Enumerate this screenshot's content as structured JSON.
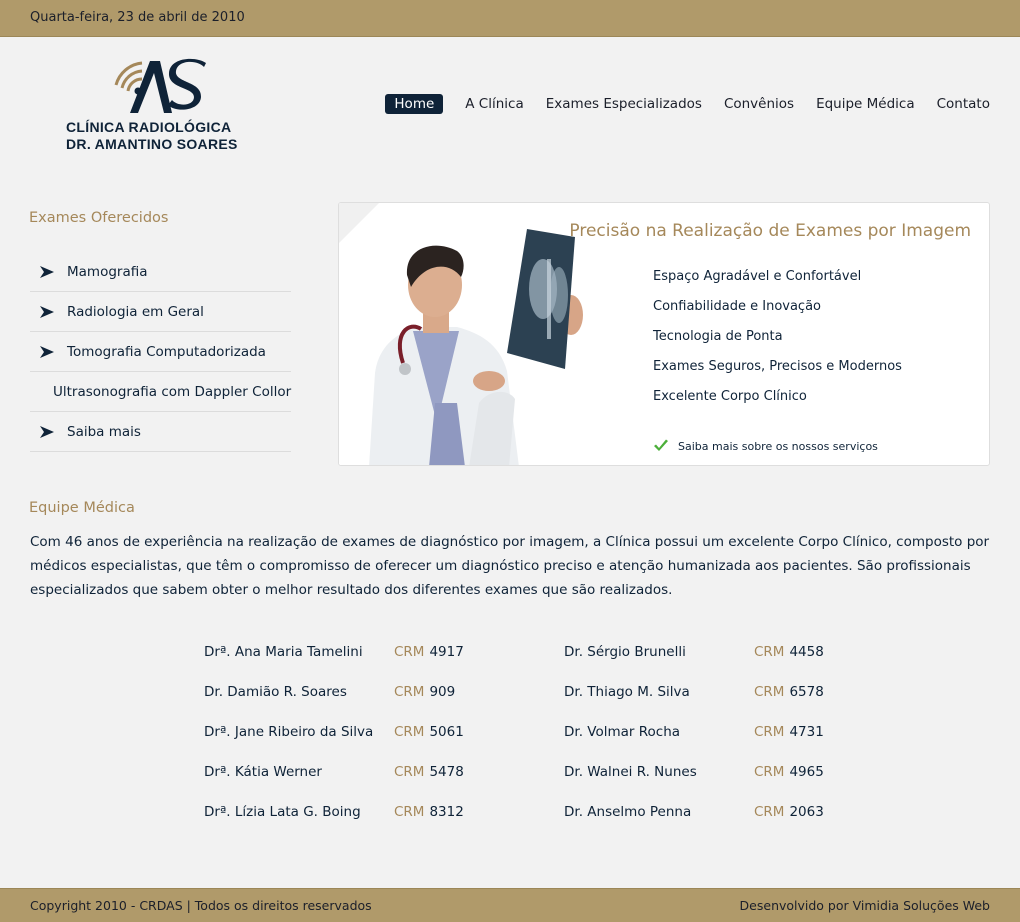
{
  "header": {
    "date": "Quarta-feira, 23 de abril de 2010"
  },
  "logo": {
    "monogram": "AS",
    "line1": "CLÍNICA  RADIOLÓGICA",
    "line2": "DR. AMANTINO SOARES"
  },
  "nav": {
    "items": [
      {
        "label": "Home",
        "active": true
      },
      {
        "label": "A Clínica"
      },
      {
        "label": "Exames Especializados"
      },
      {
        "label": "Convênios"
      },
      {
        "label": "Equipe Médica"
      },
      {
        "label": "Contato"
      }
    ]
  },
  "sidebar": {
    "title": "Exames Oferecidos",
    "items": [
      {
        "label": "Mamografia"
      },
      {
        "label": "Radiologia em Geral"
      },
      {
        "label": "Tomografia Computadorizada"
      },
      {
        "label": "Ultrasonografia com Dappler Collor"
      },
      {
        "label": "Saiba mais"
      }
    ]
  },
  "feature": {
    "title": "Precisão na Realização de Exames por Imagem",
    "bullets": [
      {
        "text": "Espaço Agradável e Confortável"
      },
      {
        "text": "Confiabilidade e Inovação"
      },
      {
        "text": "Tecnologia de Ponta"
      },
      {
        "text": "Exames Seguros, Precisos e Modernos"
      },
      {
        "text": "Excelente Corpo Clínico"
      }
    ],
    "more_link": "Saiba mais sobre os nossos serviços",
    "image_icon": "doctor-xray-image"
  },
  "team": {
    "title": "Equipe Médica",
    "paragraph": "Com 46 anos de experiência na realização de exames de diagnóstico por imagem, a Clínica possui um excelente Corpo Clínico, composto por médicos especialistas, que têm o compromisso de oferecer um diagnóstico preciso e atenção humanizada aos pacientes. São profissionais especializados que sabem obter o melhor resultado dos diferentes exames que são realizados.",
    "crm_label": "CRM",
    "doctors": [
      {
        "name": "Drª. Ana Maria Tamelini",
        "crm": "4917"
      },
      {
        "name": "Dr. Damião R. Soares",
        "crm": "909"
      },
      {
        "name": "Drª. Jane Ribeiro da Silva",
        "crm": "5061"
      },
      {
        "name": "Drª. Kátia Werner",
        "crm": "5478"
      },
      {
        "name": "Drª. Lízia Lata G. Boing",
        "crm": "8312"
      },
      {
        "name": "Dr. Sérgio Brunelli",
        "crm": "4458"
      },
      {
        "name": "Dr. Thiago M. Silva",
        "crm": "6578"
      },
      {
        "name": "Dr. Volmar Rocha",
        "crm": "4731"
      },
      {
        "name": "Dr. Walnei R. Nunes",
        "crm": "4965"
      },
      {
        "name": "Dr. Anselmo Penna",
        "crm": "2063"
      }
    ]
  },
  "footer": {
    "copyright": "Copyright 2010 - CRDAS | Todos os direitos reservados",
    "developer": "Desenvolvido por Vimidia Soluções Web"
  },
  "colors": {
    "gold": "#b09a6a",
    "gold_text": "#a5885a",
    "navy": "#0f2338",
    "background": "#f2f2f2"
  }
}
